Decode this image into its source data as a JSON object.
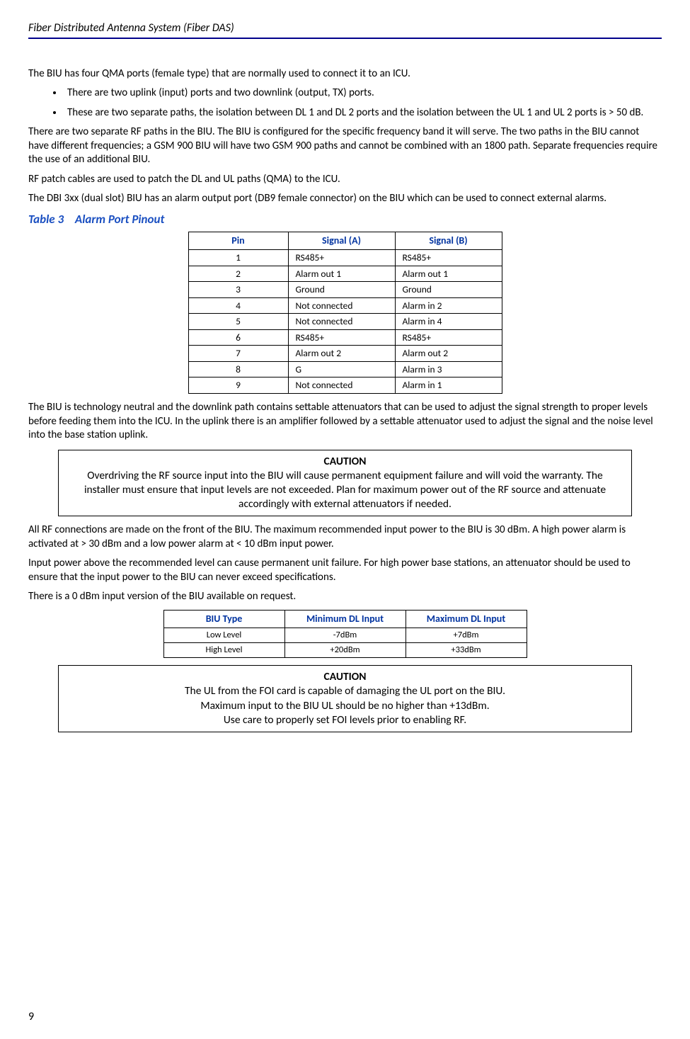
{
  "header": "Fiber Distributed Antenna System (Fiber DAS)",
  "para1": "The BIU has four QMA ports (female type) that are normally used to connect it to an ICU.",
  "bullets": [
    "There are two uplink (input) ports and two downlink (output, TX) ports.",
    "These are two separate paths, the isolation between DL 1 and DL 2 ports and the isolation between the UL 1 and UL 2 ports is > 50 dB."
  ],
  "para2": "There are two separate RF paths in the BIU. The BIU is configured for the specific frequency band it will serve. The two paths in the BIU cannot have different frequencies; a GSM 900 BIU will have two GSM 900 paths and cannot be combined with an 1800 path. Separate frequencies require the use of an additional BIU.",
  "para3": "RF patch cables are used to patch the DL and UL paths (QMA) to the ICU.",
  "para4": "The DBI 3xx (dual slot) BIU has an alarm output port (DB9 female connector) on the BIU which can be used to connect external alarms.",
  "table3_label": "Table 3",
  "table3_title": "Alarm Port Pinout",
  "table3_headers": {
    "c1": "Pin",
    "c2": "Signal (A)",
    "c3": "Signal (B)"
  },
  "table3_rows": [
    {
      "pin": "1",
      "a": "RS485+",
      "b": "RS485+"
    },
    {
      "pin": "2",
      "a": "Alarm out 1",
      "b": "Alarm out 1"
    },
    {
      "pin": "3",
      "a": "Ground",
      "b": "Ground"
    },
    {
      "pin": "4",
      "a": "Not connected",
      "b": "Alarm in 2"
    },
    {
      "pin": "5",
      "a": "Not connected",
      "b": "Alarm in 4"
    },
    {
      "pin": "6",
      "a": "RS485+",
      "b": "RS485+"
    },
    {
      "pin": "7",
      "a": "Alarm out 2",
      "b": "Alarm out 2"
    },
    {
      "pin": "8",
      "a": "G",
      "b": "Alarm in 3"
    },
    {
      "pin": "9",
      "a": "Not connected",
      "b": "Alarm in 1"
    }
  ],
  "para5": "The BIU is technology neutral and the downlink path contains settable attenuators that can be used to adjust the signal strength to proper levels before feeding them into the ICU. In the uplink there is an amplifier followed by a settable attenuator used to adjust the signal and the noise level into the base station uplink.",
  "caution1_label": "CAUTION",
  "caution1_body": "Overdriving the RF source input into the BIU will cause permanent equipment failure and will void the warranty. The installer must ensure that input levels are not exceeded. Plan for maximum power out of the RF source and attenuate accordingly with external attenuators if needed.",
  "para6": "All RF connections are made on the front of the BIU. The maximum recommended input power to the BIU is 30 dBm. A high power alarm is activated at > 30 dBm and a low power alarm at < 10 dBm input power.",
  "para7": "Input power above the recommended level can cause permanent unit failure. For high power base stations, an attenuator should be used to ensure that the input power to the BIU can never exceed specifications.",
  "para8": "There is a 0 dBm input version of the BIU available on request.",
  "table4_headers": {
    "c1": "BIU Type",
    "c2": "Minimum DL Input",
    "c3": "Maximum DL Input"
  },
  "table4_rows": [
    {
      "t": "Low Level",
      "min": "-7dBm",
      "max": "+7dBm"
    },
    {
      "t": "High Level",
      "min": "+20dBm",
      "max": "+33dBm"
    }
  ],
  "caution2_label": "CAUTION",
  "caution2_line1": "The UL from the FOI card is capable of damaging the UL port on the BIU.",
  "caution2_line2": "Maximum input to the BIU UL should be no higher than +13dBm.",
  "caution2_line3": "Use care to properly set FOI levels prior to enabling RF.",
  "page_number": "9"
}
